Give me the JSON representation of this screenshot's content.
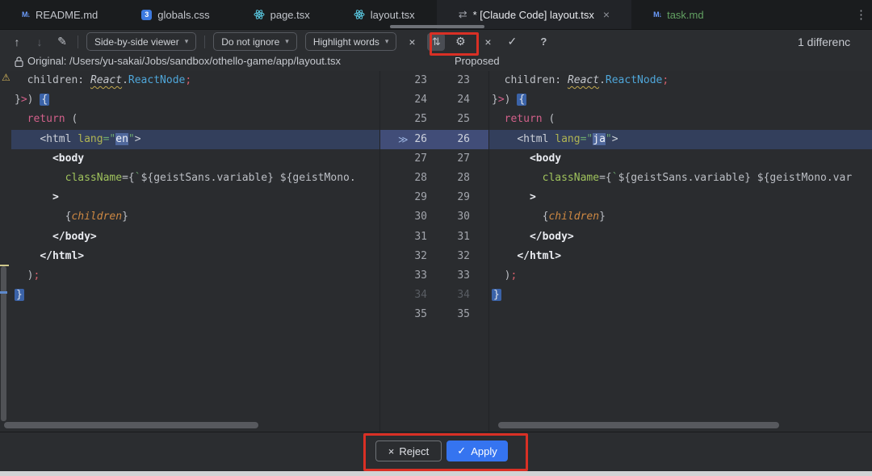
{
  "icons": {
    "previous_difference": "↑",
    "next_difference": "↓",
    "edit": "✎",
    "chevron_down": "▾",
    "collapse_x": "×",
    "sync_scroll": "⇅",
    "settings": "⚙",
    "discard_x": "×",
    "accept_check": "✓",
    "help": "?",
    "more": "⋮",
    "double_chevron": "≫",
    "warning": "⚠",
    "markdown": "M↓",
    "css": "3",
    "diff_tab": "⇄",
    "close": "×",
    "reject_x": "×",
    "apply_check": "✓"
  },
  "tabbar": {
    "tabs": [
      {
        "label": "README.md",
        "icon": "markdown-icon",
        "active": false
      },
      {
        "label": "globals.css",
        "icon": "css-icon",
        "active": false
      },
      {
        "label": "page.tsx",
        "icon": "react-icon",
        "active": false
      },
      {
        "label": "layout.tsx",
        "icon": "react-icon",
        "active": false
      },
      {
        "label": "* [Claude Code] layout.tsx",
        "icon": "diff-icon",
        "active": true,
        "closable": true
      },
      {
        "label": "task.md",
        "icon": "markdown-icon",
        "active": false,
        "label_color": "#62a162"
      }
    ]
  },
  "toolbar": {
    "viewer_mode": "Side-by-side viewer",
    "ignore_mode": "Do not ignore",
    "highlight_mode": "Highlight words",
    "diff_count": "1 differenc"
  },
  "diff_header": {
    "original": "Original: /Users/yu-sakai/Jobs/sandbox/othello-game/app/layout.tsx",
    "proposed": "Proposed"
  },
  "diff": {
    "line_start": 23,
    "line_end": 35,
    "changed_line": 26,
    "dimmed_line": 34,
    "left_lines": [
      {
        "n": 23,
        "segs": [
          [
            "p",
            "  children"
          ],
          [
            "p",
            ": "
          ],
          [
            "rw",
            "React"
          ],
          [
            "p",
            "."
          ],
          [
            "t",
            "ReactNode"
          ],
          [
            "s",
            ";"
          ]
        ]
      },
      {
        "n": 24,
        "segs": [
          [
            "p",
            "}"
          ],
          [
            "k",
            ">"
          ],
          [
            "p",
            ") "
          ],
          [
            "bm",
            "{"
          ]
        ]
      },
      {
        "n": 25,
        "segs": [
          [
            "p",
            "  "
          ],
          [
            "k",
            "return"
          ],
          [
            "p",
            " ("
          ]
        ]
      },
      {
        "n": 26,
        "segs": [
          [
            "p",
            "    "
          ],
          [
            "h",
            "<html "
          ],
          [
            "a",
            "lang"
          ],
          [
            "q",
            "=\""
          ],
          [
            "hl",
            "en"
          ],
          [
            "q",
            "\""
          ],
          [
            "h",
            ">"
          ]
        ]
      },
      {
        "n": 27,
        "segs": [
          [
            "p",
            "      "
          ],
          [
            "w",
            "<body"
          ]
        ]
      },
      {
        "n": 28,
        "segs": [
          [
            "p",
            "        "
          ],
          [
            "g",
            "className"
          ],
          [
            "p",
            "={"
          ],
          [
            "q",
            "`"
          ],
          [
            "p",
            "${geistSans.variable}"
          ],
          [
            "q",
            " "
          ],
          [
            "p",
            "${geistMono."
          ]
        ]
      },
      {
        "n": 29,
        "segs": [
          [
            "p",
            "      "
          ],
          [
            "w",
            ">"
          ]
        ]
      },
      {
        "n": 30,
        "segs": [
          [
            "p",
            "        {"
          ],
          [
            "o",
            "children"
          ],
          [
            "p",
            "}"
          ]
        ]
      },
      {
        "n": 31,
        "segs": [
          [
            "p",
            "      "
          ],
          [
            "w",
            "</body>"
          ]
        ]
      },
      {
        "n": 32,
        "segs": [
          [
            "p",
            "    "
          ],
          [
            "w",
            "</html>"
          ]
        ]
      },
      {
        "n": 33,
        "segs": [
          [
            "p",
            "  )"
          ],
          [
            "s",
            ";"
          ]
        ]
      },
      {
        "n": 34,
        "segs": [
          [
            "bm",
            "}"
          ]
        ]
      },
      {
        "n": 35,
        "segs": []
      }
    ],
    "right_lines": [
      {
        "n": 23,
        "segs": [
          [
            "p",
            "  children"
          ],
          [
            "p",
            ": "
          ],
          [
            "rw",
            "React"
          ],
          [
            "p",
            "."
          ],
          [
            "t",
            "ReactNode"
          ],
          [
            "s",
            ";"
          ]
        ]
      },
      {
        "n": 24,
        "segs": [
          [
            "p",
            "}"
          ],
          [
            "k",
            ">"
          ],
          [
            "p",
            ") "
          ],
          [
            "bm",
            "{"
          ]
        ]
      },
      {
        "n": 25,
        "segs": [
          [
            "p",
            "  "
          ],
          [
            "k",
            "return"
          ],
          [
            "p",
            " ("
          ]
        ]
      },
      {
        "n": 26,
        "segs": [
          [
            "p",
            "    "
          ],
          [
            "h",
            "<html "
          ],
          [
            "a",
            "lang"
          ],
          [
            "q",
            "=\""
          ],
          [
            "hl",
            "ja"
          ],
          [
            "q",
            "\""
          ],
          [
            "h",
            ">"
          ]
        ]
      },
      {
        "n": 27,
        "segs": [
          [
            "p",
            "      "
          ],
          [
            "w",
            "<body"
          ]
        ]
      },
      {
        "n": 28,
        "segs": [
          [
            "p",
            "        "
          ],
          [
            "g",
            "className"
          ],
          [
            "p",
            "={"
          ],
          [
            "q",
            "`"
          ],
          [
            "p",
            "${geistSans.variable}"
          ],
          [
            "q",
            " "
          ],
          [
            "p",
            "${geistMono.var"
          ]
        ]
      },
      {
        "n": 29,
        "segs": [
          [
            "p",
            "      "
          ],
          [
            "w",
            ">"
          ]
        ]
      },
      {
        "n": 30,
        "segs": [
          [
            "p",
            "        {"
          ],
          [
            "o",
            "children"
          ],
          [
            "p",
            "}"
          ]
        ]
      },
      {
        "n": 31,
        "segs": [
          [
            "p",
            "      "
          ],
          [
            "w",
            "</body>"
          ]
        ]
      },
      {
        "n": 32,
        "segs": [
          [
            "p",
            "    "
          ],
          [
            "w",
            "</html>"
          ]
        ]
      },
      {
        "n": 33,
        "segs": [
          [
            "p",
            "  )"
          ],
          [
            "s",
            ";"
          ]
        ]
      },
      {
        "n": 34,
        "segs": [
          [
            "bm",
            "}"
          ]
        ]
      },
      {
        "n": 35,
        "segs": []
      }
    ]
  },
  "footer": {
    "reject": "Reject",
    "apply": "Apply"
  },
  "colors": {
    "accent_blue": "#3574f0",
    "annotation_red": "#d93025",
    "changed_line_bg": "#333f5c",
    "changed_gutter_bg": "#414d78",
    "word_highlight_bg": "#50689c"
  }
}
